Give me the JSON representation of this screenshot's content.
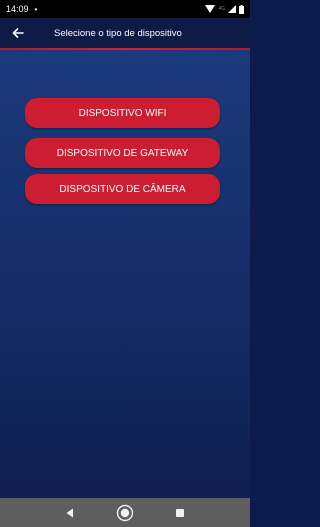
{
  "status_bar": {
    "time": "14:09",
    "dot": "•",
    "network_label": "4G"
  },
  "app_bar": {
    "title": "Selecione o tipo de dispositivo",
    "back_icon": "arrow-left-icon"
  },
  "device_buttons": [
    {
      "label": "DISPOSITIVO WIFI"
    },
    {
      "label": "DISPOSITIVO DE GATEWAY"
    },
    {
      "label": "DISPOSITIVO DE CÂMERA"
    }
  ],
  "nav_bar": {
    "icons": [
      "back-triangle-icon",
      "home-circle-icon",
      "recents-square-icon"
    ]
  },
  "colors": {
    "accent": "#cc1e30",
    "app_bar": "#0c1a45",
    "background": "#16306c"
  }
}
